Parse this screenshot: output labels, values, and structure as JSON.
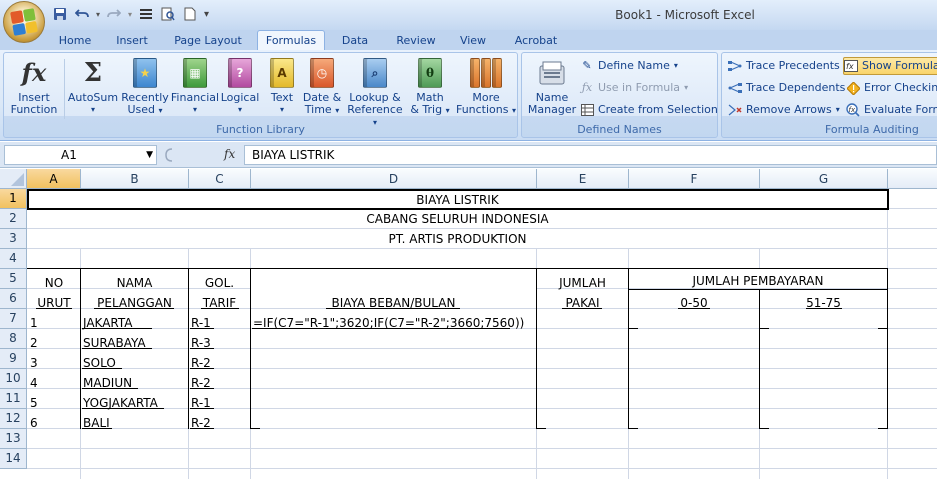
{
  "app": {
    "title": "Book1 - Microsoft Excel",
    "quick_access": [
      "save-icon",
      "undo-icon",
      "redo-icon",
      "format-icon",
      "print-preview-icon",
      "new-document-icon",
      "customize-icon"
    ]
  },
  "tabs": [
    "Home",
    "Insert",
    "Page Layout",
    "Formulas",
    "Data",
    "Review",
    "View",
    "Acrobat"
  ],
  "active_tab": "Formulas",
  "ribbon": {
    "function_library": {
      "label": "Function Library",
      "insert_function": [
        "Insert",
        "Function"
      ],
      "autosum": "AutoSum",
      "recently_used": [
        "Recently",
        "Used"
      ],
      "financial": "Financial",
      "logical": "Logical",
      "text": "Text",
      "date_time": [
        "Date &",
        "Time"
      ],
      "lookup_reference": [
        "Lookup &",
        "Reference"
      ],
      "math_trig": [
        "Math",
        "& Trig"
      ],
      "more_functions": [
        "More",
        "Functions"
      ]
    },
    "defined_names": {
      "label": "Defined Names",
      "name_manager": [
        "Name",
        "Manager"
      ],
      "define_name": "Define Name",
      "use_in_formula": "Use in Formula",
      "create_from_selection": "Create from Selection"
    },
    "formula_auditing": {
      "label": "Formula Auditing",
      "trace_precedents": "Trace Precedents",
      "trace_dependents": "Trace Dependents",
      "remove_arrows": "Remove Arrows",
      "show_formulas": "Show Formulas",
      "error_checking": "Error Checking",
      "evaluate_formula": "Evaluate Formula"
    }
  },
  "formula_bar": {
    "name_box": "A1",
    "fx": "fx",
    "content": "BIAYA LISTRIK"
  },
  "grid": {
    "columns": [
      "A",
      "B",
      "C",
      "D",
      "E",
      "F",
      "G"
    ],
    "rows": [
      "1",
      "2",
      "3",
      "4",
      "5",
      "6",
      "7",
      "8",
      "9",
      "10",
      "11",
      "12",
      "13",
      "14"
    ],
    "cells": {
      "r1": "BIAYA LISTRIK",
      "r2": "CABANG SELURUH INDONESIA",
      "r3": "PT. ARTIS PRODUKTION",
      "a5": "NO",
      "a6": "URUT",
      "b5": "NAMA",
      "b6": "PELANGGAN",
      "c5": "GOL.",
      "c6": "TARIF",
      "d6": "BIAYA BEBAN/BULAN",
      "e5": "JUMLAH",
      "e6": "PAKAI",
      "fg5": "JUMLAH PEMBAYARAN",
      "f6": "0-50",
      "g6": "51-75",
      "d7": "=IF(C7=\"R-1\";3620;IF(C7=\"R-2\";3660;7560))",
      "data_rows": [
        {
          "no": "1",
          "nama": "JAKARTA",
          "tarif": "R-1"
        },
        {
          "no": "2",
          "nama": "SURABAYA",
          "tarif": "R-3"
        },
        {
          "no": "3",
          "nama": "SOLO",
          "tarif": "R-2"
        },
        {
          "no": "4",
          "nama": "MADIUN",
          "tarif": "R-2"
        },
        {
          "no": "5",
          "nama": "YOGJAKARTA",
          "tarif": "R-1"
        },
        {
          "no": "6",
          "nama": "BALI",
          "tarif": "R-2"
        }
      ]
    }
  }
}
